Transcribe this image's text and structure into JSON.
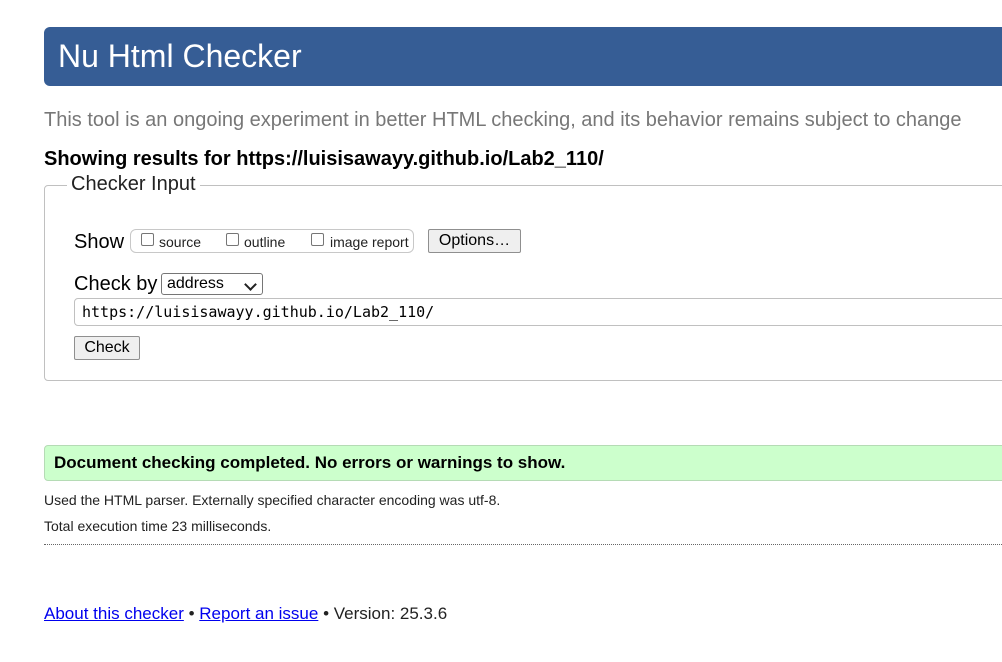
{
  "header": {
    "title": "Nu Html Checker"
  },
  "tagline": "This tool is an ongoing experiment in better HTML checking, and its behavior remains subject to change",
  "results": {
    "prefix": "Showing results for ",
    "url": "https://luisisawayy.github.io/Lab2_110/"
  },
  "checker_input": {
    "legend": "Checker Input",
    "show_label": "Show",
    "show_options": [
      {
        "label": "source",
        "checked": false
      },
      {
        "label": "outline",
        "checked": false
      },
      {
        "label": "image report",
        "checked": false
      }
    ],
    "options_button": "Options…",
    "check_by_label": "Check by",
    "check_by_selected": "address",
    "url_value": "https://luisisawayy.github.io/Lab2_110/",
    "check_button": "Check"
  },
  "status": {
    "message": "Document checking completed. No errors or warnings to show.",
    "color": "#ccffcc"
  },
  "info": {
    "parser": "Used the HTML parser. Externally specified character encoding was utf-8.",
    "time": "Total execution time 23 milliseconds."
  },
  "footer": {
    "about_link": "About this checker",
    "separator": " • ",
    "report_link": "Report an issue",
    "version_text": " • Version: 25.3.6"
  },
  "colors": {
    "header_bg": "#365d95",
    "link": "#0000ee"
  }
}
